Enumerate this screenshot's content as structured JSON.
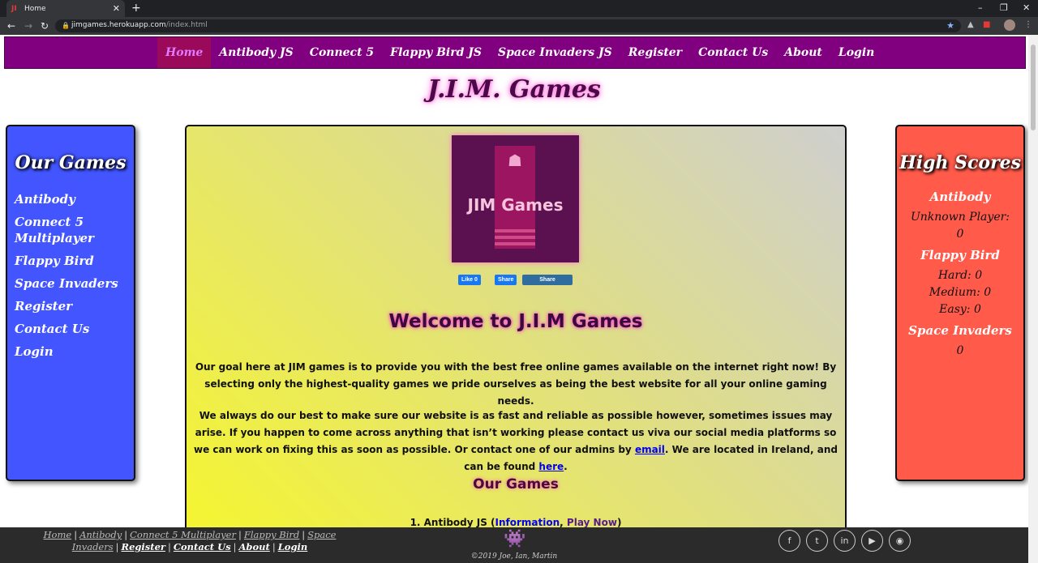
{
  "browser": {
    "tab_title": "Home",
    "tab_close": "✕",
    "new_tab": "+",
    "url_host": "jimgames.herokuapp.com",
    "url_path": "/index.html",
    "win_minimize": "–",
    "win_restore": "❐",
    "win_close": "✕"
  },
  "nav": {
    "items": [
      {
        "label": "Home"
      },
      {
        "label": "Antibody JS"
      },
      {
        "label": "Connect 5"
      },
      {
        "label": "Flappy Bird JS"
      },
      {
        "label": "Space Invaders JS"
      },
      {
        "label": "Register"
      },
      {
        "label": "Contact Us"
      },
      {
        "label": "About"
      },
      {
        "label": "Login"
      }
    ]
  },
  "site_title": "J.I.M. Games",
  "left_panel": {
    "title": "Our Games",
    "items": [
      {
        "label": "Antibody"
      },
      {
        "label": "Connect 5 Multiplayer"
      },
      {
        "label": "Flappy Bird"
      },
      {
        "label": "Space Invaders"
      },
      {
        "label": "Register"
      },
      {
        "label": "Contact Us"
      },
      {
        "label": "Login"
      }
    ]
  },
  "right_panel": {
    "title": "High Scores",
    "antibody": {
      "name": "Antibody",
      "player": "Unknown Player:",
      "score": "0"
    },
    "flappy": {
      "name": "Flappy Bird",
      "hard": "Hard: 0",
      "medium": "Medium: 0",
      "easy": "Easy: 0"
    },
    "space": {
      "name": "Space Invaders",
      "score": "0"
    }
  },
  "main": {
    "logo_text": "JIM Games",
    "share": {
      "fb_like": "Like 0",
      "fb_share": "Share",
      "li_share": "Share"
    },
    "welcome": "Welcome to J.I.M Games",
    "para1": "Our goal here at JIM games is to provide you with the best free online games available on the internet right now! By selecting only the highest-quality games we pride ourselves as being the best website for all your online gaming needs.",
    "para2_a": "We always do our best to make sure our website is as fast and reliable as possible however, sometimes issues may arise. If you happen to come across anything that isn’t working please contact us viva our social media platforms so we can work on fixing this as soon as possible. Or contact one of our admins by ",
    "para2_link1": "email",
    "para2_b": ". We are located in Ireland, and can be found ",
    "para2_link2": "here",
    "para2_c": ".",
    "our_games": "Our Games",
    "game1_prefix": "1. Antibody JS (",
    "game1_info": "Information",
    "game1_comma": ", ",
    "game1_play": "Play Now",
    "game1_suffix": ")"
  },
  "footer": {
    "links": [
      "Home",
      "Antibody",
      "Connect 5 Multiplayer",
      "Flappy Bird",
      "Space Invaders",
      "Register",
      "Contact Us",
      "About",
      "Login"
    ],
    "separator": "|",
    "copyright": "©2019 Joe, Ian, Martin",
    "social_icons": [
      "facebook-icon",
      "twitter-icon",
      "linkedin-icon",
      "youtube-icon",
      "github-icon"
    ]
  },
  "colors": {
    "nav_bg": "#800080",
    "left_panel_bg": "#4255ff",
    "right_panel_bg": "#ff5a4a",
    "footer_bg": "#2b2b2b",
    "title_color": "#4a0a4a"
  }
}
